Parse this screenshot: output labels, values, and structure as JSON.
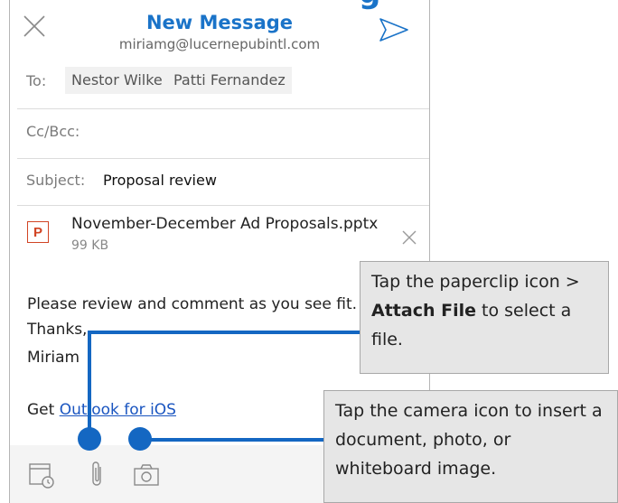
{
  "header": {
    "cut_title": "g",
    "title": "New Message",
    "account": "miriamg@lucernepubintl.com"
  },
  "recipients": {
    "to_label": "To:",
    "to": [
      "Nestor Wilke",
      "Patti Fernandez"
    ],
    "cc_label": "Cc/Bcc:"
  },
  "subject": {
    "label": "Subject:",
    "value": "Proposal review"
  },
  "attachment": {
    "icon_letter": "P",
    "name": "November-December Ad Proposals.pptx",
    "size": "99 KB"
  },
  "body": {
    "line1": "Please review and comment as you see fit.",
    "line2": "Thanks,",
    "line3": "Miriam",
    "signature_prefix": "Get ",
    "signature_link": "Outlook for iOS"
  },
  "toolbar": {
    "icons": [
      "calendar-icon",
      "paperclip-icon",
      "camera-icon"
    ]
  },
  "callouts": {
    "paperclip": {
      "prefix": "Tap the paperclip icon > ",
      "bold": "Attach File",
      "suffix": " to select a file."
    },
    "camera": {
      "text": "Tap the camera icon to insert a document, photo, or whiteboard image."
    }
  },
  "colors": {
    "accent": "#1a73c8",
    "callout_line": "#1467c2",
    "ppt": "#d14424"
  }
}
